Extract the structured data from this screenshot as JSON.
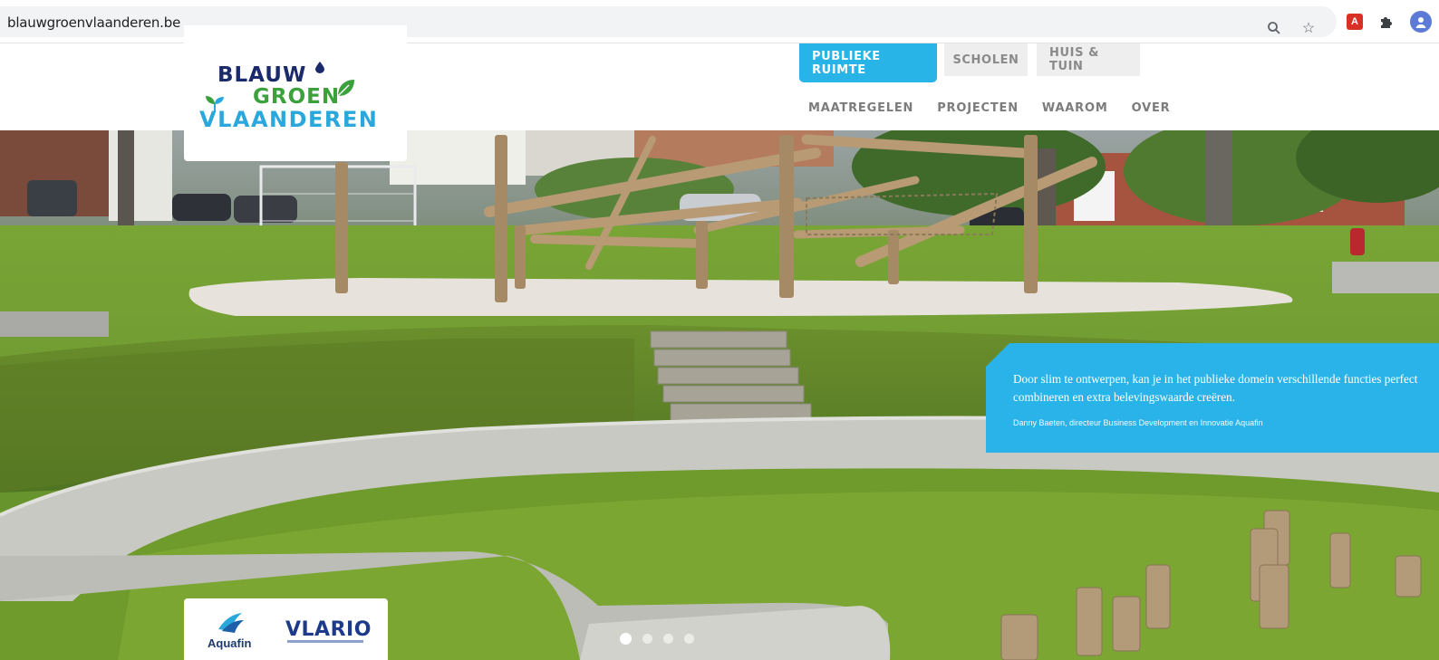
{
  "browser": {
    "url": "blauwgroenvlaanderen.be",
    "icons": [
      "zoom-icon",
      "star-icon",
      "pdf-extension-icon",
      "extensions-puzzle-icon",
      "profile-icon"
    ]
  },
  "logo": {
    "line1": "BLAUW",
    "line2": "GROEN",
    "line3": "VLAANDEREN"
  },
  "top_tabs": [
    {
      "label": "PUBLIEKE RUIMTE",
      "active": true
    },
    {
      "label": "SCHOLEN",
      "active": false
    },
    {
      "label": "HUIS & TUIN",
      "active": false
    }
  ],
  "main_nav": [
    {
      "label": "MAATREGELEN"
    },
    {
      "label": "PROJECTEN"
    },
    {
      "label": "WAAROM"
    },
    {
      "label": "OVER"
    }
  ],
  "hero": {
    "quote": "Door slim te ontwerpen, kan je in het publieke domein verschillende functies perfect combineren en extra belevingswaarde creëren.",
    "author": "Danny Baeten, directeur Business Development en Innovatie Aquafin",
    "slides_total": 4,
    "slide_active": 1
  },
  "partners": {
    "aquafin": "Aquafin",
    "vlario": "VLARIO"
  },
  "colors": {
    "accent_blue": "#29b4e8",
    "logo_navy": "#1b2a6b",
    "logo_green": "#3aa13c",
    "logo_light_blue": "#2aa8dc"
  }
}
